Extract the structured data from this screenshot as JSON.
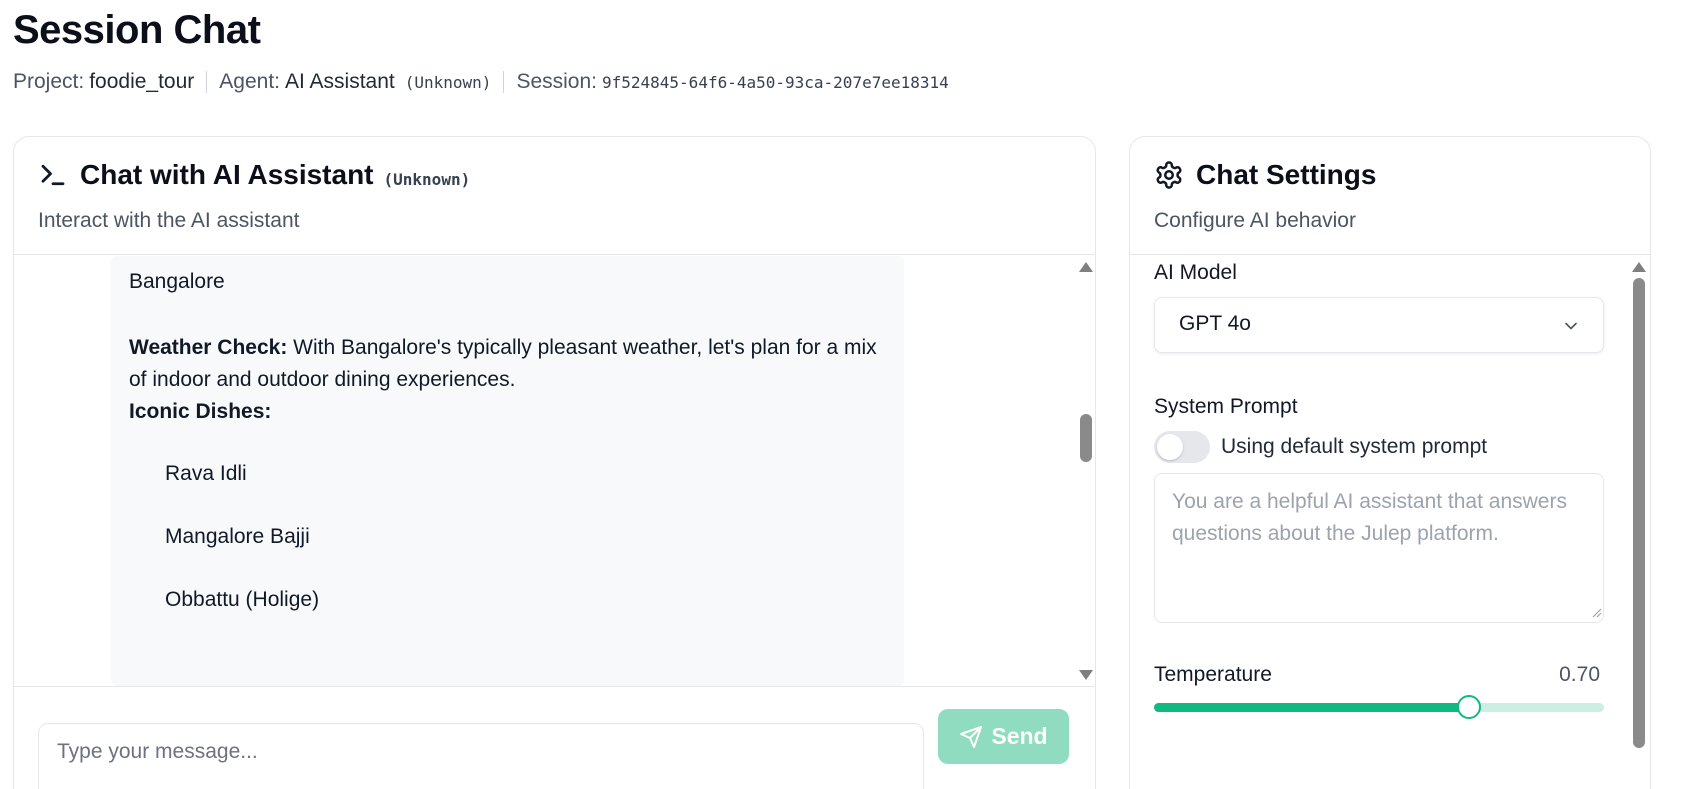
{
  "header": {
    "title": "Session Chat",
    "project_label": "Project:",
    "project_value": "foodie_tour",
    "agent_label": "Agent:",
    "agent_value": "AI Assistant",
    "agent_tag": "(Unknown)",
    "session_label": "Session:",
    "session_value": "9f524845-64f6-4a50-93ca-207e7ee18314"
  },
  "chat": {
    "title": "Chat with AI Assistant",
    "tag": "(Unknown)",
    "subtitle": "Interact with the AI assistant",
    "message": {
      "line_city": "Bangalore",
      "weather_label": "Weather Check:",
      "weather_text": " With Bangalore's typically pleasant weather, let's plan for a mix of indoor and outdoor dining experiences.",
      "dishes_label": "Iconic Dishes:",
      "dishes": [
        "Rava Idli",
        "Mangalore Bajji",
        "Obbattu (Holige)"
      ]
    },
    "input_placeholder": "Type your message...",
    "send_label": "Send",
    "scroll_position": 0.4
  },
  "settings": {
    "title": "Chat Settings",
    "subtitle": "Configure AI behavior",
    "model_label": "AI Model",
    "model_value": "GPT 4o",
    "system_prompt_label": "System Prompt",
    "toggle_label": "Using default system prompt",
    "toggle_on": false,
    "prompt_placeholder": "You are a helpful AI assistant that answers questions about the Julep platform.",
    "temperature_label": "Temperature",
    "temperature_value": "0.70",
    "temperature_fraction": 0.7
  },
  "colors": {
    "accent": "#10b981",
    "send_button_disabled": "#8fdcc0",
    "slider_track": "#cdeee2"
  },
  "icons": {
    "chat_title": "terminal-icon",
    "settings_title": "gear-icon",
    "send": "send-icon",
    "select": "chevron-down-icon"
  }
}
